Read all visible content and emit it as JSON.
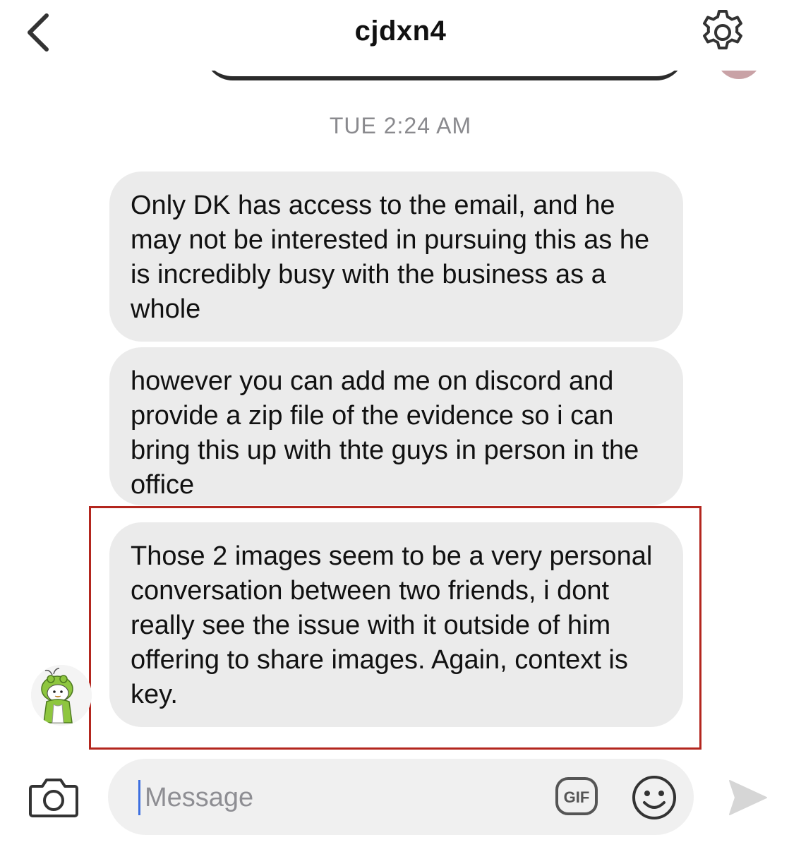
{
  "header": {
    "title": "cjdxn4"
  },
  "conversation": {
    "timestamp": "TUE 2:24 AM",
    "messages": [
      {
        "text": "Only DK has access to the email, and he may not be interested in pursuing this as he is incredibly busy with the business as a whole"
      },
      {
        "text": "however you can add me on discord and provide a zip file of the evidence so i can bring this up with thte guys in person in the office"
      },
      {
        "text": "Those 2 images seem to be a very personal conversation between two friends, i dont really see the issue with it outside of him offering to share images. Again, context is key."
      }
    ]
  },
  "composer": {
    "placeholder": "Message",
    "gif_label": "GIF"
  },
  "icons": {
    "back": "chevron-left-icon",
    "settings": "gear-icon",
    "camera": "camera-icon",
    "gif": "gif-icon",
    "emoji": "smiley-icon",
    "send": "send-icon"
  },
  "colors": {
    "bubble": "#ebebeb",
    "highlight": "#b3261e",
    "cursor": "#3d6fe0",
    "timestamp": "#8a8a8e"
  }
}
